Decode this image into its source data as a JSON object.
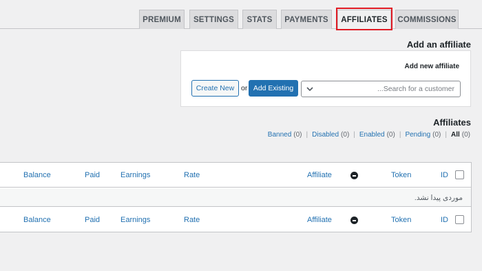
{
  "tabs": [
    {
      "label": "PREMIUM"
    },
    {
      "label": "SETTINGS"
    },
    {
      "label": "STATS"
    },
    {
      "label": "PAYMENTS"
    },
    {
      "label": "AFFILIATES",
      "active": true
    },
    {
      "label": "COMMISSIONS"
    }
  ],
  "add_section": {
    "title": "Add an affiliate",
    "subtitle": "Add new affiliate",
    "create_new_label": "Create New",
    "or_label": "or",
    "add_existing_label": "Add Existing",
    "search_placeholder": "...Search for a customer"
  },
  "affiliates_section": {
    "title": "Affiliates",
    "filters": [
      {
        "label": "Banned",
        "count": "(0)"
      },
      {
        "label": "Disabled",
        "count": "(0)"
      },
      {
        "label": "Enabled",
        "count": "(0)"
      },
      {
        "label": "Pending",
        "count": "(0)"
      },
      {
        "label": "All",
        "count": "(0)",
        "current": true
      }
    ]
  },
  "table": {
    "columns": {
      "balance": "Balance",
      "paid": "Paid",
      "earnings": "Earnings",
      "rate": "Rate",
      "affiliate": "Affiliate",
      "token": "Token",
      "id": "ID"
    },
    "empty_message": "موردی پیدا نشد."
  },
  "colors": {
    "accent": "#2271b1",
    "highlight": "#e01b24",
    "background": "#f0f0f1"
  }
}
